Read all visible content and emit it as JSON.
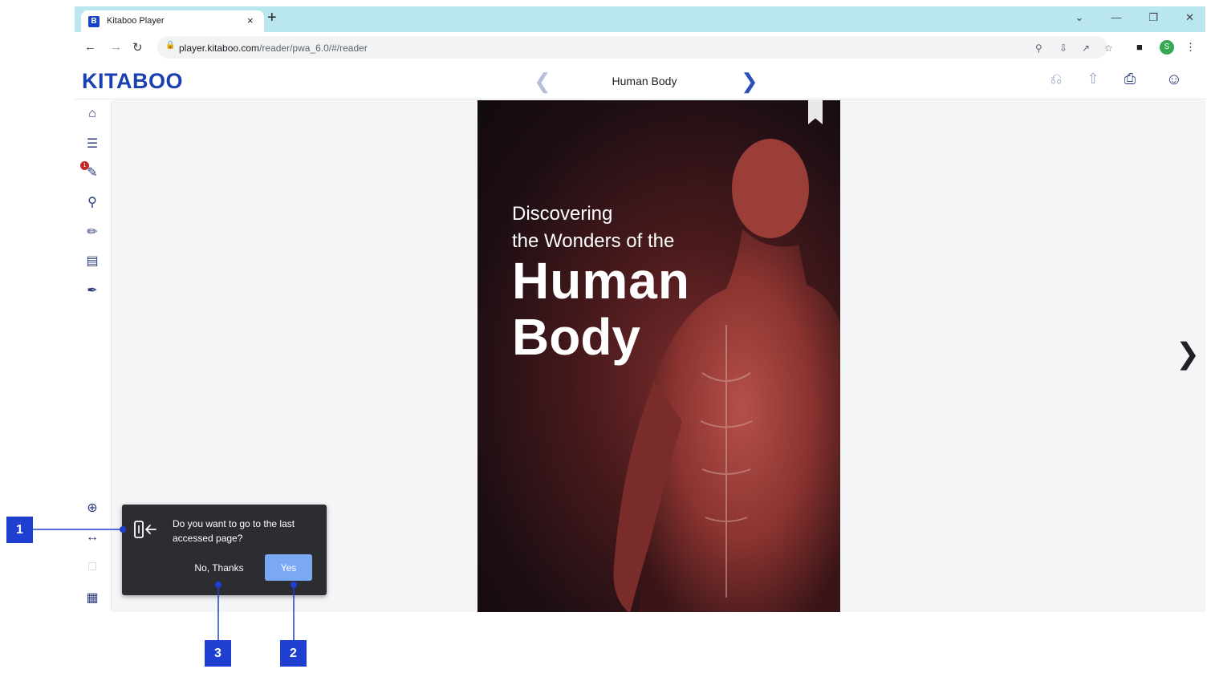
{
  "browser": {
    "tab_favicon": "B",
    "tab_title": "Kitaboo Player",
    "tab_close": "×",
    "new_tab": "+",
    "url_host": "player.kitaboo.com",
    "url_path": "/reader/pwa_6.0/#/reader",
    "profile_initial": "S"
  },
  "header": {
    "logo": "KITABOO",
    "title": "Human Body",
    "prev_icon": "chevron-left-icon",
    "next_icon": "chevron-right-icon"
  },
  "cover": {
    "line1": "Discovering",
    "line2": "the Wonders of the",
    "line3": "Human",
    "line4": "Body"
  },
  "sidebar": {
    "notes_badge": "1"
  },
  "popup": {
    "message": "Do you want to go to the last accessed page?",
    "no_label": "No, Thanks",
    "yes_label": "Yes"
  },
  "callouts": {
    "c1": "1",
    "c2": "2",
    "c3": "3"
  },
  "colors": {
    "brand": "#1a3fb0",
    "callout": "#1f3fd1",
    "yes_button": "#7aa8f3",
    "popup_bg": "#2b2d31"
  }
}
